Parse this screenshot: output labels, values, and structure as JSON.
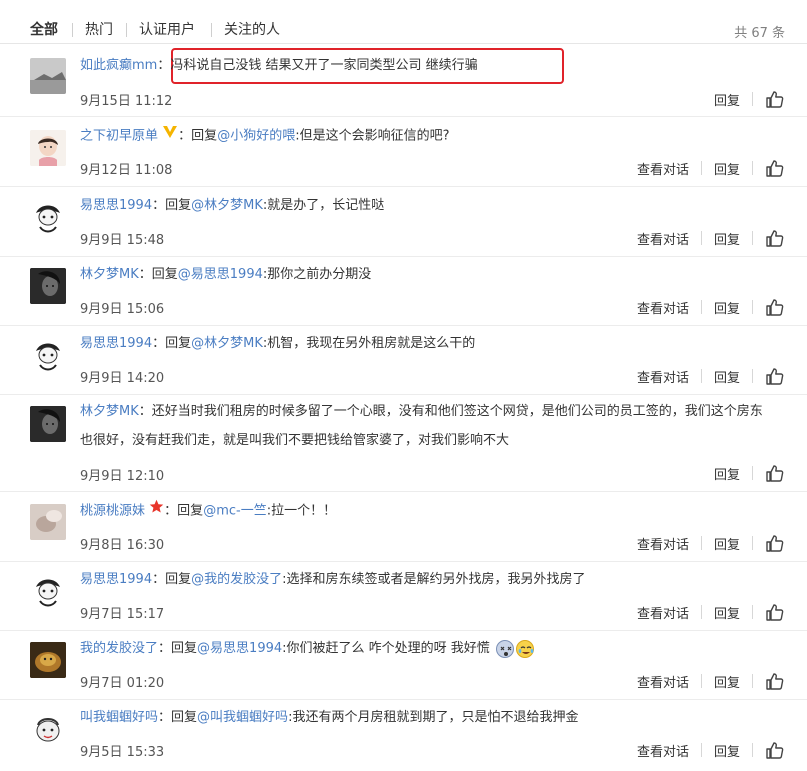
{
  "tabs": [
    {
      "label": "全部",
      "active": true
    },
    {
      "label": "热门",
      "active": false
    },
    {
      "label": "认证用户",
      "active": false
    },
    {
      "label": "关注的人",
      "active": false
    }
  ],
  "total": "共 67 条",
  "actions": {
    "view_conversation": "查看对话",
    "reply": "回复"
  },
  "comments": [
    {
      "user": "如此疯癫mm",
      "reply_prefix": "",
      "mention": "",
      "text": "冯科说自己没钱 结果又开了一家同类型公司 继续行骗",
      "time": "9月15日 11:12",
      "show_conversation": false
    },
    {
      "user": "之下初早原单",
      "reply_prefix": "回复",
      "mention": "@小狗好的喂",
      "text": "但是这个会影响征信的吧?",
      "time": "9月12日 11:08",
      "show_conversation": true
    },
    {
      "user": "易思思1994",
      "reply_prefix": "回复",
      "mention": "@林夕梦MK",
      "text": "就是办了，长记性哒",
      "time": "9月9日 15:48",
      "show_conversation": true
    },
    {
      "user": "林夕梦MK",
      "reply_prefix": "回复",
      "mention": "@易思思1994",
      "text": "那你之前办分期没",
      "time": "9月9日 15:06",
      "show_conversation": true
    },
    {
      "user": "易思思1994",
      "reply_prefix": "回复",
      "mention": "@林夕梦MK",
      "text": "机智，我现在另外租房就是这么干的",
      "time": "9月9日 14:20",
      "show_conversation": true
    },
    {
      "user": "林夕梦MK",
      "reply_prefix": "",
      "mention": "",
      "text": "还好当时我们租房的时候多留了一个心眼，没有和他们签这个网贷，是他们公司的员工签的，我们这个房东也很好，没有赶我们走，就是叫我们不要把钱给管家婆了，对我们影响不大",
      "time": "9月9日 12:10",
      "show_conversation": false
    },
    {
      "user": "桃源桃源妹",
      "reply_prefix": "回复",
      "mention": "@mc-一竺",
      "text": "拉一个！！",
      "time": "9月8日 16:30",
      "show_conversation": true
    },
    {
      "user": "易思思1994",
      "reply_prefix": "回复",
      "mention": "@我的发胶没了",
      "text": "选择和房东续签或者是解约另外找房，我另外找房了",
      "time": "9月7日 15:17",
      "show_conversation": true
    },
    {
      "user": "我的发胶没了",
      "reply_prefix": "回复",
      "mention": "@易思思1994",
      "text": "你们被赶了么 咋个处理的呀 我好慌",
      "time": "9月7日 01:20",
      "show_conversation": true
    },
    {
      "user": "叫我蝈蝈好吗",
      "reply_prefix": "回复",
      "mention": "@叫我蝈蝈好吗",
      "text": "我还有两个月房租就到期了，只是怕不退给我押金",
      "time": "9月5日 15:33",
      "show_conversation": true
    }
  ],
  "colors": {
    "link": "#4a7dc2",
    "highlight": "#e0232a",
    "badge_vip": "#f5b400",
    "badge_star": "#e8352b"
  },
  "icons": [
    "thumbs-up-icon",
    "vip-badge-icon",
    "star-badge-icon",
    "dizzy-face-emoji-icon",
    "laughing-tears-emoji-icon"
  ]
}
